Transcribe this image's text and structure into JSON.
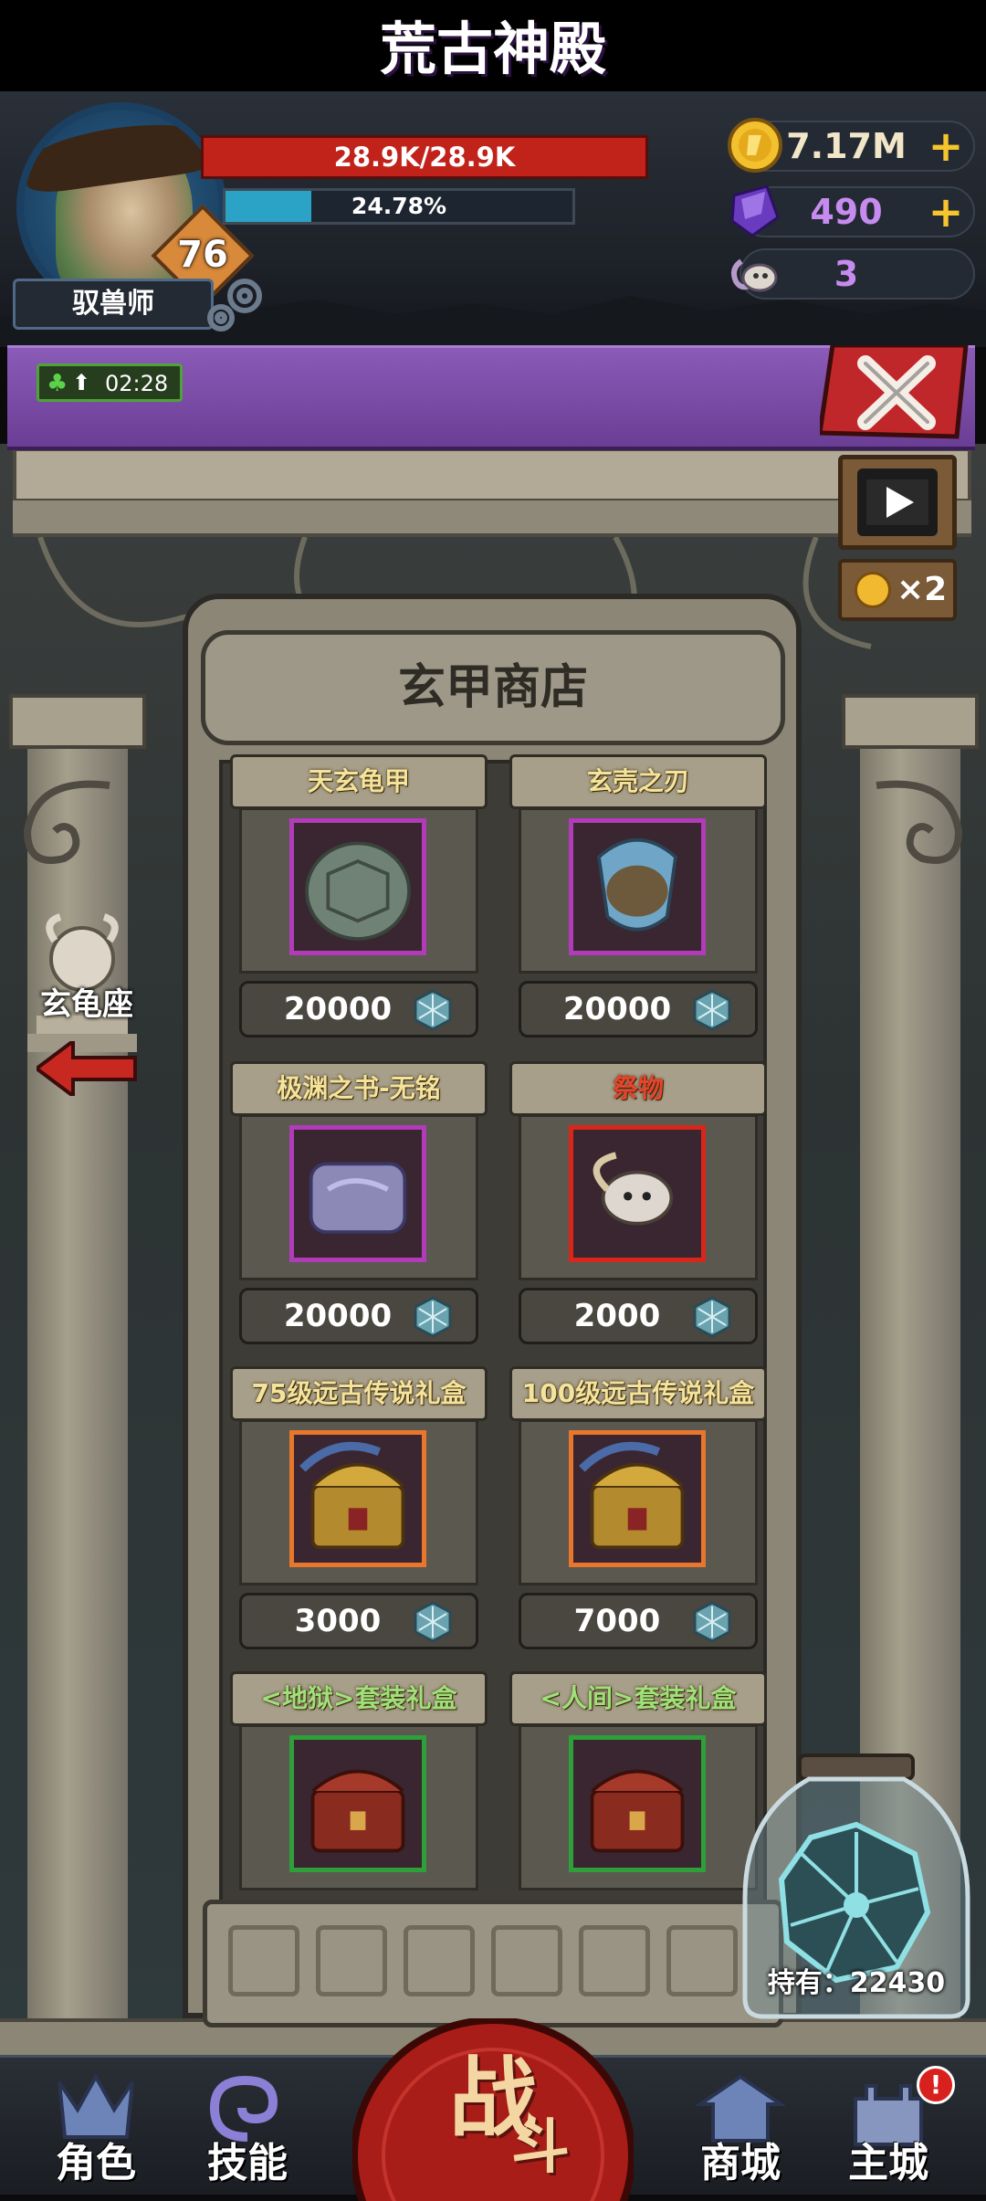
{
  "player": {
    "level": "76",
    "class_name": "驭兽师",
    "hp_text": "28.9K/28.9K",
    "exp_text": "24.78%",
    "exp_fraction": 0.2478
  },
  "resources": {
    "gold": "7.17M",
    "gems": "490",
    "ram_skull": "3"
  },
  "buff": {
    "timer": "02:28"
  },
  "title": "荒古神殿",
  "side_button": {
    "label": "玄龟座"
  },
  "double_reward": {
    "label": "×2"
  },
  "shop": {
    "title": "玄甲商店",
    "items": [
      {
        "name": "天玄龟甲",
        "price": "20000",
        "name_color": "#f4e39a",
        "frame": "#b13bb8"
      },
      {
        "name": "玄壳之刃",
        "price": "20000",
        "name_color": "#f4e39a",
        "frame": "#b13bb8"
      },
      {
        "name": "极渊之书-无铭",
        "price": "20000",
        "name_color": "#f4e39a",
        "frame": "#b13bb8"
      },
      {
        "name": "祭物",
        "price": "2000",
        "name_color": "#e8432d",
        "frame": "#d8261b"
      },
      {
        "name": "75级远古传说礼盒",
        "price": "3000",
        "name_color": "#f4e39a",
        "frame": "#e8762c"
      },
      {
        "name": "100级远古传说礼盒",
        "price": "7000",
        "name_color": "#f4e39a",
        "frame": "#e8762c"
      },
      {
        "name": "<地狱>套装礼盒",
        "price": "",
        "name_color": "#9fe07a",
        "frame": "#2f9f3a"
      },
      {
        "name": "<人间>套装礼盒",
        "price": "",
        "name_color": "#9fe07a",
        "frame": "#2f9f3a"
      }
    ]
  },
  "currency_jar": {
    "label": "持有：22430"
  },
  "nav": {
    "role": "角色",
    "skill": "技能",
    "battle_1": "战",
    "battle_2": "斗",
    "store": "商城",
    "city": "主城",
    "notification": "!"
  }
}
